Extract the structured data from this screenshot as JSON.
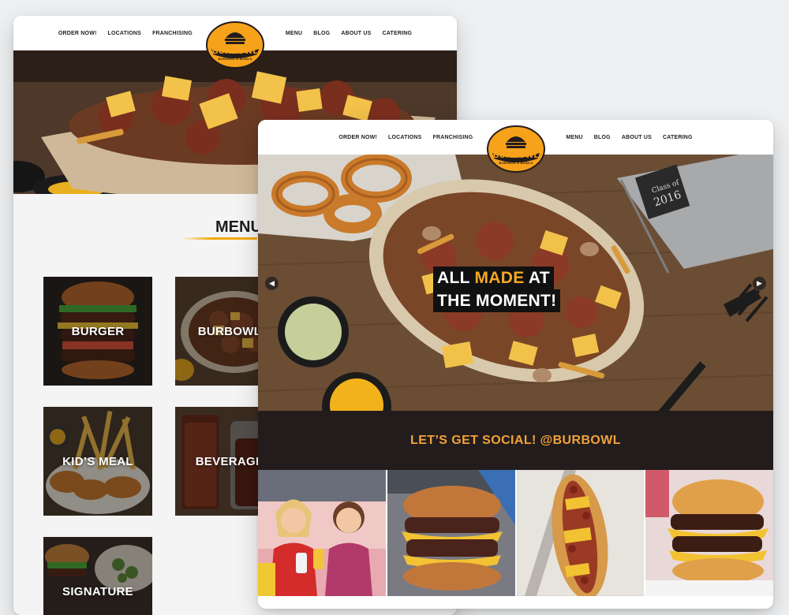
{
  "brand": {
    "name": "BURBOWL",
    "tagline": "BURGERS & BOWLS",
    "colors": {
      "accent": "#f5a823",
      "dark": "#231c1c",
      "logo_fill": "#f7a21b"
    }
  },
  "nav": {
    "left": [
      "ORDER NOW!",
      "LOCATIONS",
      "FRANCHISING"
    ],
    "right": [
      "MENU",
      "BLOG",
      "ABOUT US",
      "CATERING"
    ]
  },
  "back_page": {
    "menu_heading": "MENU",
    "tiles": [
      {
        "label": "BURGER"
      },
      {
        "label": "BURBOWL"
      },
      {
        "label": "KID’S MEAL"
      },
      {
        "label": "BEVERAGE"
      },
      {
        "label": "SIGNATURE"
      }
    ]
  },
  "front_page": {
    "hero": {
      "headline_line1_a": "ALL ",
      "headline_line1_b": "MADE",
      "headline_line1_c": " AT",
      "headline_line2": "THE MOMENT!",
      "prev_icon": "chevron-left-icon",
      "next_icon": "chevron-right-icon",
      "cup_text_line1": "Class of",
      "cup_text_line2": "2016"
    },
    "social": {
      "heading": "LET’S GET SOCIAL! @BURBOWL",
      "photos": [
        "friends-photo",
        "burger-photo",
        "hotdog-photo",
        "stacked-burger-photo"
      ]
    }
  }
}
